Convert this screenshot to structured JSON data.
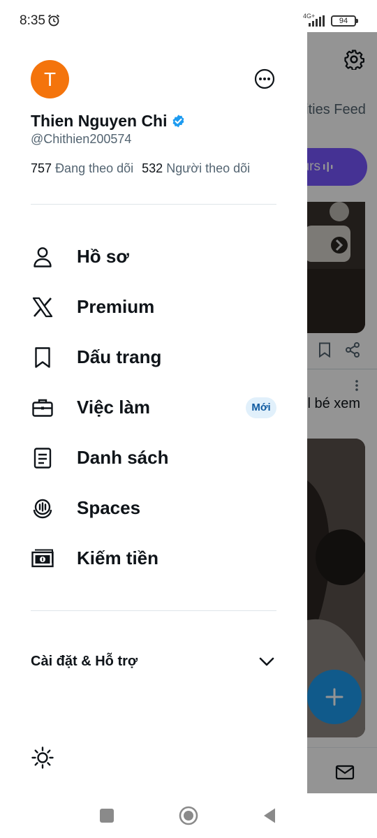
{
  "status_bar": {
    "time": "8:35",
    "network": "4G+",
    "battery": "94"
  },
  "background_feed": {
    "tab_partial": "nities Feed",
    "spaces_pill_partial": "ours",
    "post_text_partial": "ll bé xem"
  },
  "drawer": {
    "avatar_initial": "T",
    "display_name": "Thien Nguyen Chi",
    "handle": "@Chithien200574",
    "following_count": "757",
    "following_label": "Đang theo dõi",
    "followers_count": "532",
    "followers_label": "Người theo dõi",
    "menu": [
      {
        "label": "Hồ sơ",
        "icon": "profile-icon"
      },
      {
        "label": "Premium",
        "icon": "x-logo-icon"
      },
      {
        "label": "Dấu trang",
        "icon": "bookmark-icon"
      },
      {
        "label": "Việc làm",
        "icon": "briefcase-icon",
        "badge": "Mới"
      },
      {
        "label": "Danh sách",
        "icon": "list-icon"
      },
      {
        "label": "Spaces",
        "icon": "spaces-icon"
      },
      {
        "label": "Kiếm tiền",
        "icon": "money-icon"
      }
    ],
    "settings_label": "Cài đặt & Hỗ trợ"
  },
  "colors": {
    "accent_blue": "#1d9bf0",
    "avatar_orange": "#f4740c",
    "spaces_purple": "#7856ff",
    "badge_bg": "#e1f0fb",
    "text_primary": "#0f1419",
    "text_secondary": "#536471"
  }
}
